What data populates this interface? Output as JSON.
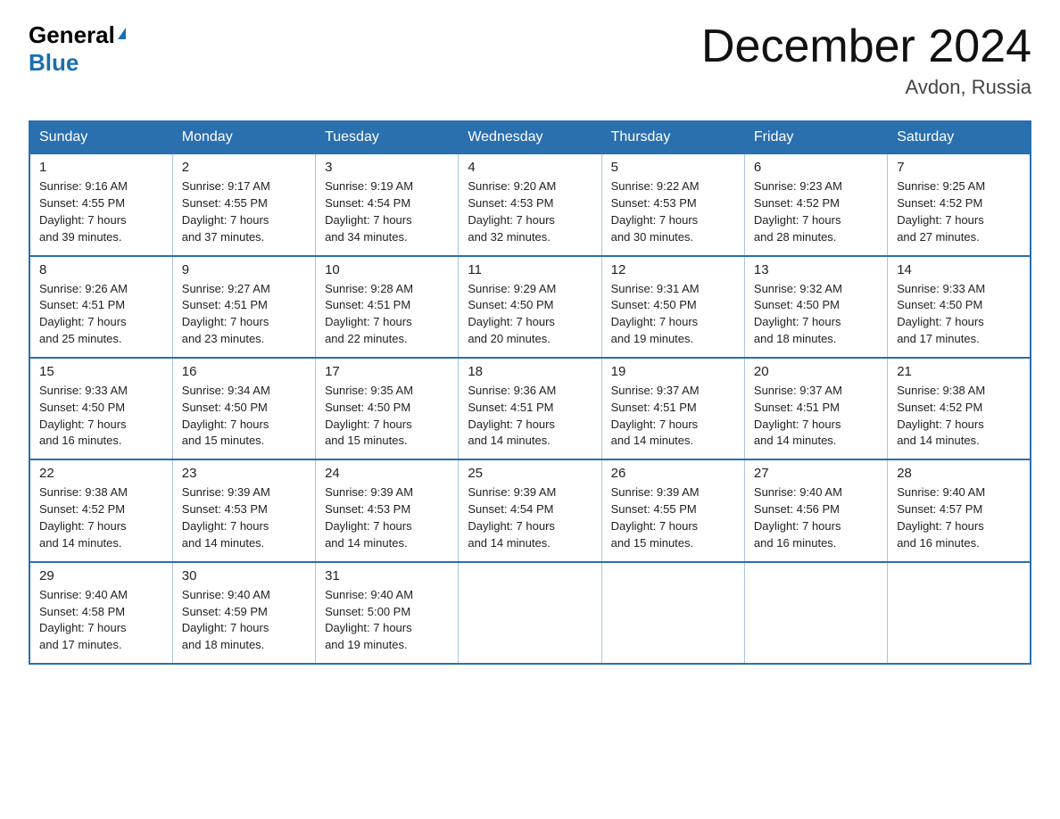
{
  "logo": {
    "general": "General",
    "blue": "Blue",
    "triangle": "▲"
  },
  "title": "December 2024",
  "subtitle": "Avdon, Russia",
  "days_of_week": [
    "Sunday",
    "Monday",
    "Tuesday",
    "Wednesday",
    "Thursday",
    "Friday",
    "Saturday"
  ],
  "weeks": [
    [
      {
        "day": "1",
        "sunrise": "9:16 AM",
        "sunset": "4:55 PM",
        "daylight": "7 hours and 39 minutes."
      },
      {
        "day": "2",
        "sunrise": "9:17 AM",
        "sunset": "4:55 PM",
        "daylight": "7 hours and 37 minutes."
      },
      {
        "day": "3",
        "sunrise": "9:19 AM",
        "sunset": "4:54 PM",
        "daylight": "7 hours and 34 minutes."
      },
      {
        "day": "4",
        "sunrise": "9:20 AM",
        "sunset": "4:53 PM",
        "daylight": "7 hours and 32 minutes."
      },
      {
        "day": "5",
        "sunrise": "9:22 AM",
        "sunset": "4:53 PM",
        "daylight": "7 hours and 30 minutes."
      },
      {
        "day": "6",
        "sunrise": "9:23 AM",
        "sunset": "4:52 PM",
        "daylight": "7 hours and 28 minutes."
      },
      {
        "day": "7",
        "sunrise": "9:25 AM",
        "sunset": "4:52 PM",
        "daylight": "7 hours and 27 minutes."
      }
    ],
    [
      {
        "day": "8",
        "sunrise": "9:26 AM",
        "sunset": "4:51 PM",
        "daylight": "7 hours and 25 minutes."
      },
      {
        "day": "9",
        "sunrise": "9:27 AM",
        "sunset": "4:51 PM",
        "daylight": "7 hours and 23 minutes."
      },
      {
        "day": "10",
        "sunrise": "9:28 AM",
        "sunset": "4:51 PM",
        "daylight": "7 hours and 22 minutes."
      },
      {
        "day": "11",
        "sunrise": "9:29 AM",
        "sunset": "4:50 PM",
        "daylight": "7 hours and 20 minutes."
      },
      {
        "day": "12",
        "sunrise": "9:31 AM",
        "sunset": "4:50 PM",
        "daylight": "7 hours and 19 minutes."
      },
      {
        "day": "13",
        "sunrise": "9:32 AM",
        "sunset": "4:50 PM",
        "daylight": "7 hours and 18 minutes."
      },
      {
        "day": "14",
        "sunrise": "9:33 AM",
        "sunset": "4:50 PM",
        "daylight": "7 hours and 17 minutes."
      }
    ],
    [
      {
        "day": "15",
        "sunrise": "9:33 AM",
        "sunset": "4:50 PM",
        "daylight": "7 hours and 16 minutes."
      },
      {
        "day": "16",
        "sunrise": "9:34 AM",
        "sunset": "4:50 PM",
        "daylight": "7 hours and 15 minutes."
      },
      {
        "day": "17",
        "sunrise": "9:35 AM",
        "sunset": "4:50 PM",
        "daylight": "7 hours and 15 minutes."
      },
      {
        "day": "18",
        "sunrise": "9:36 AM",
        "sunset": "4:51 PM",
        "daylight": "7 hours and 14 minutes."
      },
      {
        "day": "19",
        "sunrise": "9:37 AM",
        "sunset": "4:51 PM",
        "daylight": "7 hours and 14 minutes."
      },
      {
        "day": "20",
        "sunrise": "9:37 AM",
        "sunset": "4:51 PM",
        "daylight": "7 hours and 14 minutes."
      },
      {
        "day": "21",
        "sunrise": "9:38 AM",
        "sunset": "4:52 PM",
        "daylight": "7 hours and 14 minutes."
      }
    ],
    [
      {
        "day": "22",
        "sunrise": "9:38 AM",
        "sunset": "4:52 PM",
        "daylight": "7 hours and 14 minutes."
      },
      {
        "day": "23",
        "sunrise": "9:39 AM",
        "sunset": "4:53 PM",
        "daylight": "7 hours and 14 minutes."
      },
      {
        "day": "24",
        "sunrise": "9:39 AM",
        "sunset": "4:53 PM",
        "daylight": "7 hours and 14 minutes."
      },
      {
        "day": "25",
        "sunrise": "9:39 AM",
        "sunset": "4:54 PM",
        "daylight": "7 hours and 14 minutes."
      },
      {
        "day": "26",
        "sunrise": "9:39 AM",
        "sunset": "4:55 PM",
        "daylight": "7 hours and 15 minutes."
      },
      {
        "day": "27",
        "sunrise": "9:40 AM",
        "sunset": "4:56 PM",
        "daylight": "7 hours and 16 minutes."
      },
      {
        "day": "28",
        "sunrise": "9:40 AM",
        "sunset": "4:57 PM",
        "daylight": "7 hours and 16 minutes."
      }
    ],
    [
      {
        "day": "29",
        "sunrise": "9:40 AM",
        "sunset": "4:58 PM",
        "daylight": "7 hours and 17 minutes."
      },
      {
        "day": "30",
        "sunrise": "9:40 AM",
        "sunset": "4:59 PM",
        "daylight": "7 hours and 18 minutes."
      },
      {
        "day": "31",
        "sunrise": "9:40 AM",
        "sunset": "5:00 PM",
        "daylight": "7 hours and 19 minutes."
      },
      null,
      null,
      null,
      null
    ]
  ]
}
